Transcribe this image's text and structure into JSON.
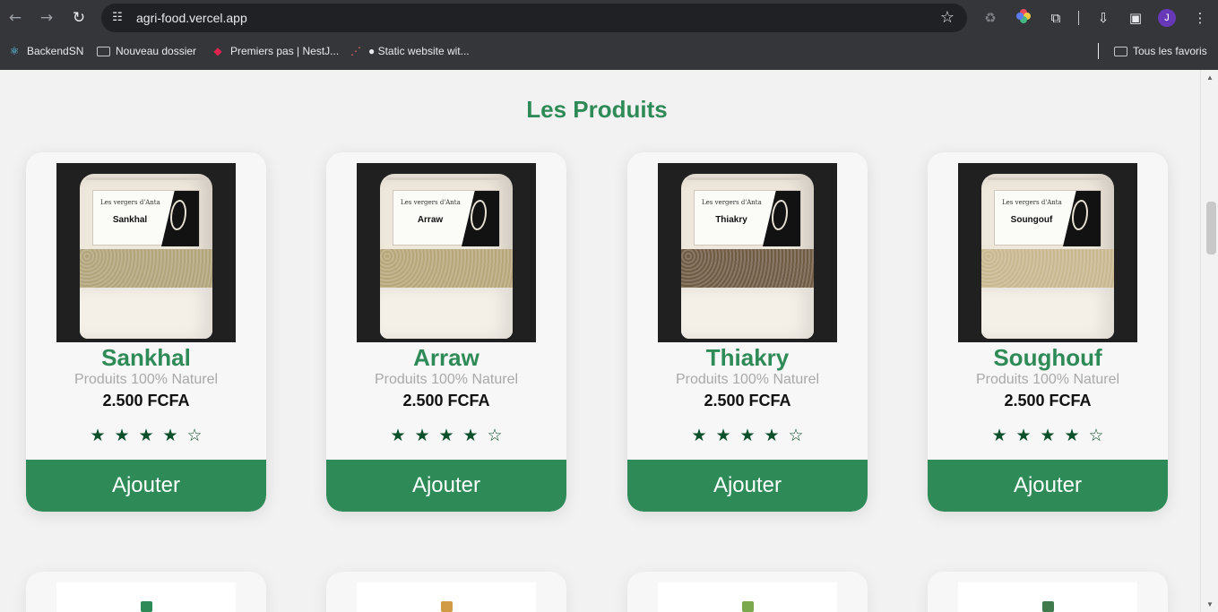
{
  "browser": {
    "url": "agri-food.vercel.app",
    "profile_initial": "J",
    "icons": {
      "back": "arrow-left-icon",
      "forward": "arrow-right-icon",
      "reload": "reload-icon",
      "site_settings": "tune-icon",
      "bookmark_star": "star-outline-icon",
      "extensions": "puzzle-icon",
      "downloads": "download-icon",
      "side_panel": "side-panel-icon",
      "menu": "kebab-menu-icon"
    },
    "bookmarks": [
      {
        "label": "BackendSN",
        "icon": "react-icon"
      },
      {
        "label": "Nouveau dossier",
        "icon": "folder-icon"
      },
      {
        "label": "Premiers pas | NestJ...",
        "icon": "nest-icon"
      },
      {
        "label": "● Static website wit...",
        "icon": "three-dots-icon"
      },
      {
        "label": "Tous les favoris",
        "icon": "folder-icon"
      }
    ]
  },
  "page": {
    "section_title": "Les Produits",
    "products": [
      {
        "name": "Sankhal",
        "label_text": "Sankhal",
        "brand_text": "Les vergers d'Anta",
        "tagline": "Produits 100% Naturel",
        "price": "2.500 FCFA",
        "rating": 4,
        "rating_max": 5,
        "button_label": "Ajouter",
        "grain_color": "#b1a47a"
      },
      {
        "name": "Arraw",
        "label_text": "Arraw",
        "brand_text": "Les vergers d'Anta",
        "tagline": "Produits 100% Naturel",
        "price": "2.500 FCFA",
        "rating": 4,
        "rating_max": 5,
        "button_label": "Ajouter",
        "grain_color": "#b6a679"
      },
      {
        "name": "Thiakry",
        "label_text": "Thiakry",
        "brand_text": "Les vergers d'Anta",
        "tagline": "Produits 100% Naturel",
        "price": "2.500 FCFA",
        "rating": 4,
        "rating_max": 5,
        "button_label": "Ajouter",
        "grain_color": "#6f5a44"
      },
      {
        "name": "Soughouf",
        "label_text": "Soungouf",
        "brand_text": "Les vergers d'Anta",
        "tagline": "Produits 100% Naturel",
        "price": "2.500 FCFA",
        "rating": 4,
        "rating_max": 5,
        "button_label": "Ajouter",
        "grain_color": "#c8b78f"
      }
    ],
    "next_row_jar_colors": [
      "#2e8b57",
      "#d19b45",
      "#7aa84d",
      "#3f7b4c"
    ]
  },
  "theme": {
    "accent": "#2e8b57",
    "star": "#0b4f2b",
    "muted_text": "#a9a9a9"
  }
}
